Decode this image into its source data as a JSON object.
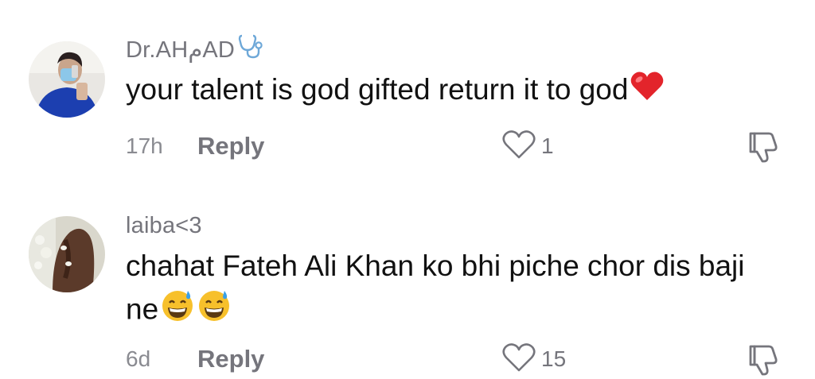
{
  "comments": [
    {
      "username": "Dr.AHمAD",
      "username_icon": "stethoscope-icon",
      "text": "your talent is god gifted return it to god",
      "text_emoji": "red-heart-icon",
      "time": "17h",
      "reply_label": "Reply",
      "like_count": "1"
    },
    {
      "username": "laiba<3",
      "text_line1": "chahat Fateh Ali Khan ko bhi piche chor dis baji",
      "text_line2": "ne",
      "text_emoji": "grinning-sweat-face-icon",
      "time": "6d",
      "reply_label": "Reply",
      "like_count": "15"
    }
  ],
  "colors": {
    "username": "#75757c",
    "text": "#111111",
    "meta": "#8a8b91",
    "heart": "#e3242b",
    "stethoscope": "#6ea8d8"
  }
}
